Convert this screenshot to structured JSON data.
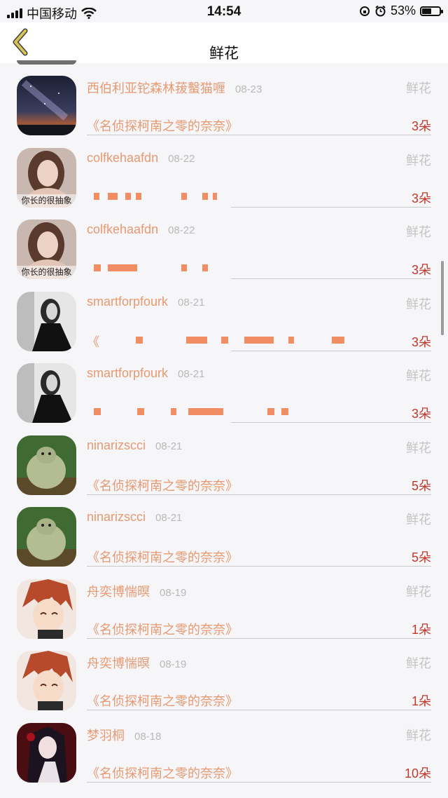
{
  "status_bar": {
    "carrier": "中国移动",
    "time": "14:54",
    "battery": "53%",
    "battery_fill": 0.53
  },
  "header": {
    "title": "鲜花",
    "back_icon": "chevron-left-icon",
    "accent": "#d8c25a"
  },
  "colors": {
    "name": "#e69a72",
    "count": "#c0392b",
    "gift_type": "#c4c4c4"
  },
  "rows": [
    {
      "name": "西伯利亚铊森林菝蟿猫喱",
      "date": "08-23",
      "gift_type": "鲜花",
      "book": "《名侦探柯南之零的奈奈》",
      "count": "3朵",
      "avatar": "starry-sky-avatar"
    },
    {
      "name": "colfkehaafdn",
      "date": "08-22",
      "gift_type": "鲜花",
      "book": "",
      "count": "3朵",
      "avatar": "girl-avatar",
      "avatar_caption": "你长的很抽象"
    },
    {
      "name": "colfkehaafdn",
      "date": "08-22",
      "gift_type": "鲜花",
      "book": "",
      "count": "3朵",
      "avatar": "girl-avatar",
      "avatar_caption": "你长的很抽象"
    },
    {
      "name": "smartforpfourk",
      "date": "08-21",
      "gift_type": "鲜花",
      "book": "《",
      "count": "3朵",
      "avatar": "woman-bw-avatar"
    },
    {
      "name": "smartforpfourk",
      "date": "08-21",
      "gift_type": "鲜花",
      "book": "",
      "count": "3朵",
      "avatar": "woman-bw-avatar"
    },
    {
      "name": "ninarizscci",
      "date": "08-21",
      "gift_type": "鲜花",
      "book": "《名侦探柯南之零的奈奈》",
      "count": "5朵",
      "avatar": "ogre-avatar"
    },
    {
      "name": "ninarizscci",
      "date": "08-21",
      "gift_type": "鲜花",
      "book": "《名侦探柯南之零的奈奈》",
      "count": "5朵",
      "avatar": "ogre-avatar"
    },
    {
      "name": "舟奕博惴暝",
      "date": "08-19",
      "gift_type": "鲜花",
      "book": "《名侦探柯南之零的奈奈》",
      "count": "1朵",
      "avatar": "anime-boy-avatar"
    },
    {
      "name": "舟奕博惴暝",
      "date": "08-19",
      "gift_type": "鲜花",
      "book": "《名侦探柯南之零的奈奈》",
      "count": "1朵",
      "avatar": "anime-boy-avatar"
    },
    {
      "name": "梦羽桐",
      "date": "08-18",
      "gift_type": "鲜花",
      "book": "《名侦探柯南之零的奈奈》",
      "count": "10朵",
      "avatar": "anime-girl-avatar"
    }
  ]
}
